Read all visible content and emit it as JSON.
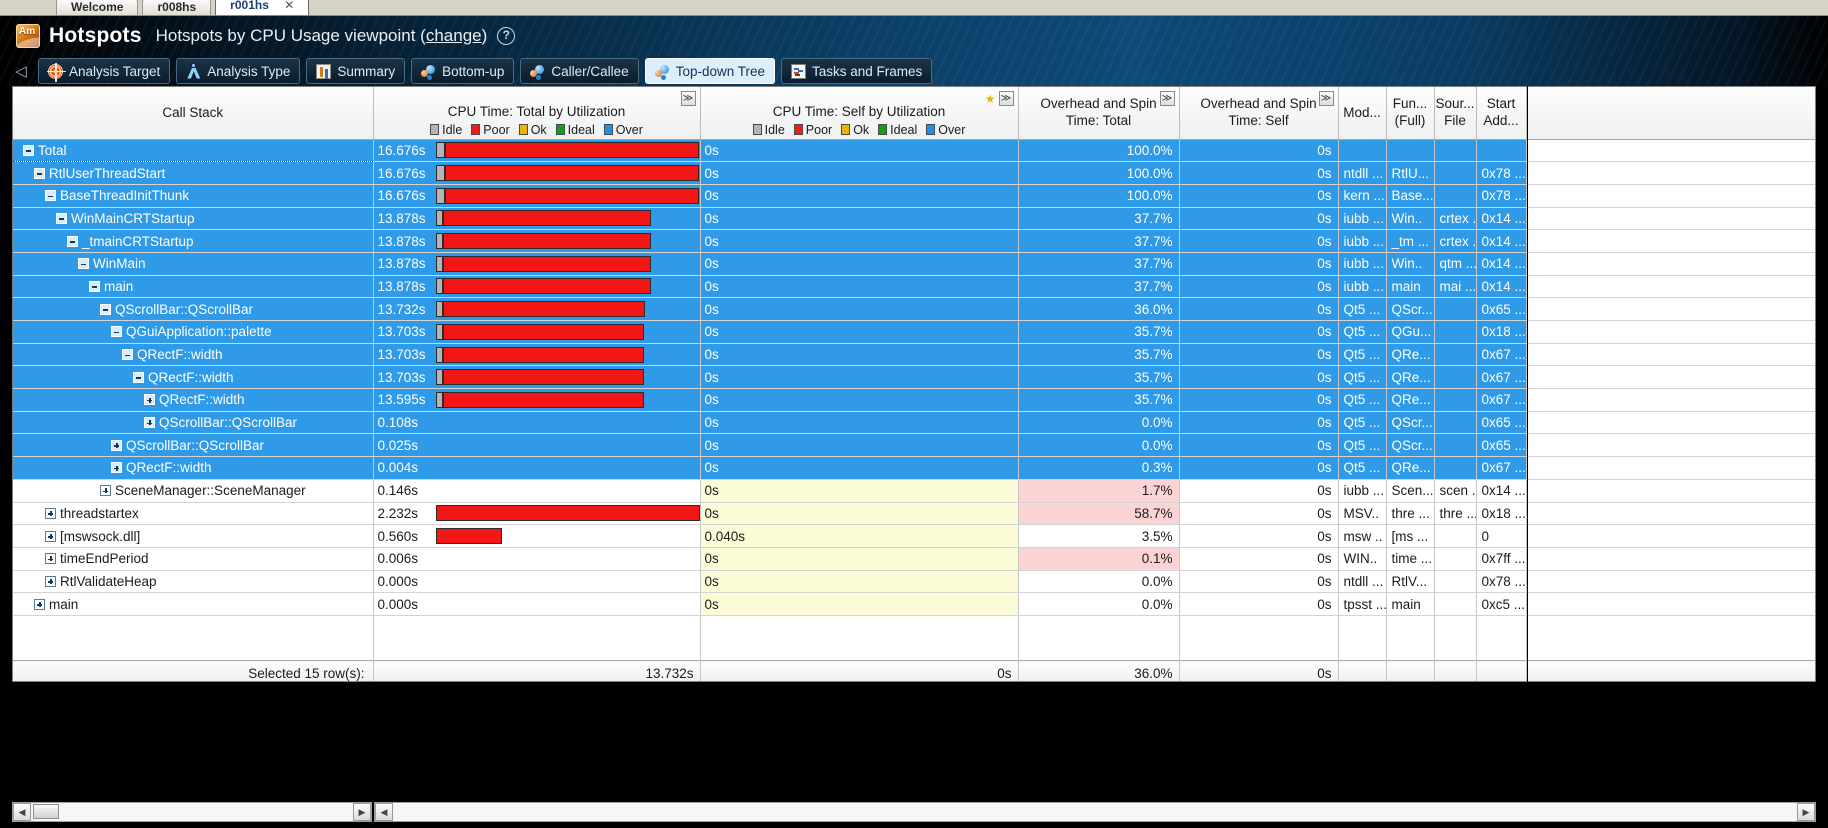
{
  "window": {
    "editor_tabs": [
      {
        "label": "Welcome",
        "active": false
      },
      {
        "label": "r008hs",
        "active": false
      },
      {
        "label": "r001hs",
        "active": true,
        "close": "✕"
      }
    ]
  },
  "header": {
    "logo_text": "Am",
    "title": "Hotspots",
    "subtitle": "Hotspots by CPU Usage viewpoint",
    "change_link": "change",
    "help_icon": "?",
    "nav_back": "◁",
    "tabs": [
      {
        "label": "Analysis Target",
        "icon": "target-icon",
        "active": false
      },
      {
        "label": "Analysis Type",
        "icon": "compass-icon",
        "active": false
      },
      {
        "label": "Summary",
        "icon": "summary-icon",
        "active": false
      },
      {
        "label": "Bottom-up",
        "icon": "molecules-icon",
        "active": false
      },
      {
        "label": "Caller/Callee",
        "icon": "molecules-icon",
        "active": false
      },
      {
        "label": "Top-down Tree",
        "icon": "molecules-icon",
        "active": true
      },
      {
        "label": "Tasks and Frames",
        "icon": "tasks-icon",
        "active": false
      }
    ]
  },
  "grid": {
    "columns": {
      "call_stack": "Call Stack",
      "cpu_total": "CPU Time: Total by Utilization",
      "cpu_self": "CPU Time: Self by Utilization",
      "overhead_total_l1": "Overhead and Spin",
      "overhead_total_l2": "Time: Total",
      "overhead_self_l1": "Overhead and Spin",
      "overhead_self_l2": "Time: Self",
      "module": "Mod...",
      "function_l1": "Fun...",
      "function_l2": "(Full)",
      "source_l1": "Sour...",
      "source_l2": "File",
      "start_l1": "Start",
      "start_l2": "Add..."
    },
    "expand_glyph": "≫",
    "star_glyph": "★",
    "legend": [
      {
        "label": "Idle",
        "color": "#b4b4b4"
      },
      {
        "label": "Poor",
        "color": "#ef1c1c"
      },
      {
        "label": "Ok",
        "color": "#f0b400"
      },
      {
        "label": "Ideal",
        "color": "#12a112"
      },
      {
        "label": "Over",
        "color": "#1f8fe8"
      }
    ],
    "rows": [
      {
        "name": "Total",
        "depth": 0,
        "expander": "minus",
        "selected": true,
        "cursor": true,
        "total": "16.676s",
        "idle_pct": 3.5,
        "poor_pct": 96.5,
        "self": "0s",
        "self_hl": "none",
        "oh_total": "100.0%",
        "oh_total_hl": "none",
        "oh_self": "0s",
        "module": "",
        "function": "",
        "source": "",
        "start": ""
      },
      {
        "name": "RtlUserThreadStart",
        "depth": 1,
        "expander": "minus",
        "selected": true,
        "total": "16.676s",
        "idle_pct": 3.5,
        "poor_pct": 96.5,
        "self": "0s",
        "self_hl": "none",
        "oh_total": "100.0%",
        "oh_total_hl": "none",
        "oh_self": "0s",
        "module": "ntdll ...",
        "function": "RtlU...",
        "source": "",
        "start": "0x78 ..."
      },
      {
        "name": "BaseThreadInitThunk",
        "depth": 2,
        "expander": "minus",
        "selected": true,
        "total": "16.676s",
        "idle_pct": 3.5,
        "poor_pct": 96.5,
        "self": "0s",
        "self_hl": "none",
        "oh_total": "100.0%",
        "oh_total_hl": "none",
        "oh_self": "0s",
        "module": "kern ...",
        "function": "Base...",
        "source": "",
        "start": "0x78 ..."
      },
      {
        "name": "WinMainCRTStartup",
        "depth": 3,
        "expander": "minus",
        "selected": true,
        "total": "13.878s",
        "idle_pct": 3.0,
        "poor_pct": 78.5,
        "self": "0s",
        "self_hl": "none",
        "oh_total": "37.7%",
        "oh_total_hl": "none",
        "oh_self": "0s",
        "module": "iubb ...",
        "function": "Win..",
        "source": "crtex ...",
        "start": "0x14 ..."
      },
      {
        "name": "_tmainCRTStartup",
        "depth": 4,
        "expander": "minus",
        "selected": true,
        "total": "13.878s",
        "idle_pct": 3.0,
        "poor_pct": 78.5,
        "self": "0s",
        "self_hl": "none",
        "oh_total": "37.7%",
        "oh_total_hl": "none",
        "oh_self": "0s",
        "module": "iubb ...",
        "function": "_tm ...",
        "source": "crtex ...",
        "start": "0x14 ..."
      },
      {
        "name": "WinMain",
        "depth": 5,
        "expander": "minus",
        "selected": true,
        "total": "13.878s",
        "idle_pct": 3.0,
        "poor_pct": 78.5,
        "self": "0s",
        "self_hl": "none",
        "oh_total": "37.7%",
        "oh_total_hl": "none",
        "oh_self": "0s",
        "module": "iubb ...",
        "function": "Win..",
        "source": "qtm ...",
        "start": "0x14 ..."
      },
      {
        "name": "main",
        "depth": 6,
        "expander": "minus",
        "selected": true,
        "total": "13.878s",
        "idle_pct": 3.0,
        "poor_pct": 78.5,
        "self": "0s",
        "self_hl": "none",
        "oh_total": "37.7%",
        "oh_total_hl": "none",
        "oh_self": "0s",
        "module": "iubb ...",
        "function": "main",
        "source": "mai ...",
        "start": "0x14 ..."
      },
      {
        "name": "QScrollBar::QScrollBar",
        "depth": 7,
        "expander": "minus",
        "selected": true,
        "total": "13.732s",
        "idle_pct": 3.0,
        "poor_pct": 76.5,
        "self": "0s",
        "self_hl": "none",
        "oh_total": "36.0%",
        "oh_total_hl": "none",
        "oh_self": "0s",
        "module": "Qt5 ...",
        "function": "QScr...",
        "source": "",
        "start": "0x65 ..."
      },
      {
        "name": "QGuiApplication::palette",
        "depth": 8,
        "expander": "minus",
        "selected": true,
        "total": "13.703s",
        "idle_pct": 3.0,
        "poor_pct": 76.0,
        "self": "0s",
        "self_hl": "none",
        "oh_total": "35.7%",
        "oh_total_hl": "none",
        "oh_self": "0s",
        "module": "Qt5 ...",
        "function": "QGu...",
        "source": "",
        "start": "0x18 ..."
      },
      {
        "name": "QRectF::width",
        "depth": 9,
        "expander": "minus",
        "selected": true,
        "total": "13.703s",
        "idle_pct": 3.0,
        "poor_pct": 76.0,
        "self": "0s",
        "self_hl": "none",
        "oh_total": "35.7%",
        "oh_total_hl": "none",
        "oh_self": "0s",
        "module": "Qt5 ...",
        "function": "QRe...",
        "source": "",
        "start": "0x67 ..."
      },
      {
        "name": "QRectF::width",
        "depth": 10,
        "expander": "minus",
        "selected": true,
        "total": "13.703s",
        "idle_pct": 3.0,
        "poor_pct": 76.0,
        "self": "0s",
        "self_hl": "none",
        "oh_total": "35.7%",
        "oh_total_hl": "none",
        "oh_self": "0s",
        "module": "Qt5 ...",
        "function": "QRe...",
        "source": "",
        "start": "0x67 ..."
      },
      {
        "name": "QRectF::width",
        "depth": 11,
        "expander": "plus",
        "selected": true,
        "total": "13.595s",
        "idle_pct": 3.0,
        "poor_pct": 76.0,
        "self": "0s",
        "self_hl": "none",
        "oh_total": "35.7%",
        "oh_total_hl": "none",
        "oh_self": "0s",
        "module": "Qt5 ...",
        "function": "QRe...",
        "source": "",
        "start": "0x67 ..."
      },
      {
        "name": "QScrollBar::QScrollBar",
        "depth": 11,
        "expander": "plus",
        "selected": true,
        "total": "0.108s",
        "idle_pct": 0,
        "poor_pct": 0,
        "self": "0s",
        "self_hl": "none",
        "oh_total": "0.0%",
        "oh_total_hl": "none",
        "oh_self": "0s",
        "module": "Qt5 ...",
        "function": "QScr...",
        "source": "",
        "start": "0x65 ..."
      },
      {
        "name": "QScrollBar::QScrollBar",
        "depth": 8,
        "expander": "plus",
        "selected": true,
        "total": "0.025s",
        "idle_pct": 0,
        "poor_pct": 0,
        "self": "0s",
        "self_hl": "none",
        "oh_total": "0.0%",
        "oh_total_hl": "none",
        "oh_self": "0s",
        "module": "Qt5 ...",
        "function": "QScr...",
        "source": "",
        "start": "0x65 ..."
      },
      {
        "name": "QRectF::width",
        "depth": 8,
        "expander": "plus",
        "selected": true,
        "total": "0.004s",
        "idle_pct": 0,
        "poor_pct": 0,
        "self": "0s",
        "self_hl": "none",
        "oh_total": "0.3%",
        "oh_total_hl": "pink",
        "oh_self": "0s",
        "module": "Qt5 ...",
        "function": "QRe...",
        "source": "",
        "start": "0x67 ..."
      },
      {
        "name": "SceneManager::SceneManager",
        "depth": 7,
        "expander": "plus",
        "selected": false,
        "total": "0.146s",
        "idle_pct": 0,
        "poor_pct": 0,
        "self": "0s",
        "self_hl": "yellow",
        "oh_total": "1.7%",
        "oh_total_hl": "pink",
        "oh_self": "0s",
        "module": "iubb ...",
        "function": "Scen...",
        "source": "scen ...",
        "start": "0x14 ..."
      },
      {
        "name": "threadstartex",
        "depth": 2,
        "expander": "plus",
        "selected": false,
        "total": "2.232s",
        "idle_pct": 0,
        "poor_pct": 100,
        "self": "0s",
        "self_hl": "yellow",
        "oh_total": "58.7%",
        "oh_total_hl": "pink",
        "oh_self": "0s",
        "module": "MSV..",
        "function": "thre ...",
        "source": "thre ...",
        "start": "0x18 ..."
      },
      {
        "name": "[mswsock.dll]",
        "depth": 2,
        "expander": "plus",
        "selected": false,
        "total": "0.560s",
        "idle_pct": 0,
        "poor_pct": 25,
        "self": "0.040s",
        "self_hl": "yellow",
        "oh_total": "3.5%",
        "oh_total_hl": "none",
        "oh_self": "0s",
        "module": "msw ..",
        "function": "[ms ...",
        "source": "",
        "start": "0"
      },
      {
        "name": "timeEndPeriod",
        "depth": 2,
        "expander": "plus",
        "selected": false,
        "total": "0.006s",
        "idle_pct": 0,
        "poor_pct": 0,
        "self": "0s",
        "self_hl": "yellow",
        "oh_total": "0.1%",
        "oh_total_hl": "pink",
        "oh_self": "0s",
        "module": "WIN..",
        "function": "time ...",
        "source": "",
        "start": "0x7ff ..."
      },
      {
        "name": "RtlValidateHeap",
        "depth": 2,
        "expander": "plus",
        "selected": false,
        "total": "0.000s",
        "idle_pct": 0,
        "poor_pct": 0,
        "self": "0s",
        "self_hl": "yellow",
        "oh_total": "0.0%",
        "oh_total_hl": "none",
        "oh_self": "0s",
        "module": "ntdll ...",
        "function": "RtlV...",
        "source": "",
        "start": "0x78 ..."
      },
      {
        "name": "main",
        "depth": 1,
        "expander": "plus",
        "selected": false,
        "total": "0.000s",
        "idle_pct": 0,
        "poor_pct": 0,
        "self": "0s",
        "self_hl": "yellow",
        "oh_total": "0.0%",
        "oh_total_hl": "none",
        "oh_self": "0s",
        "module": "tpsst ...",
        "function": "main",
        "source": "",
        "start": "0xc5 ..."
      }
    ],
    "footer": {
      "label": "Selected 15 row(s):",
      "total": "13.732s",
      "self": "0s",
      "oh_total": "36.0%",
      "oh_self": "0s"
    }
  },
  "scrollbars": {
    "left_arrow": "◀",
    "right_arrow": "▶"
  }
}
